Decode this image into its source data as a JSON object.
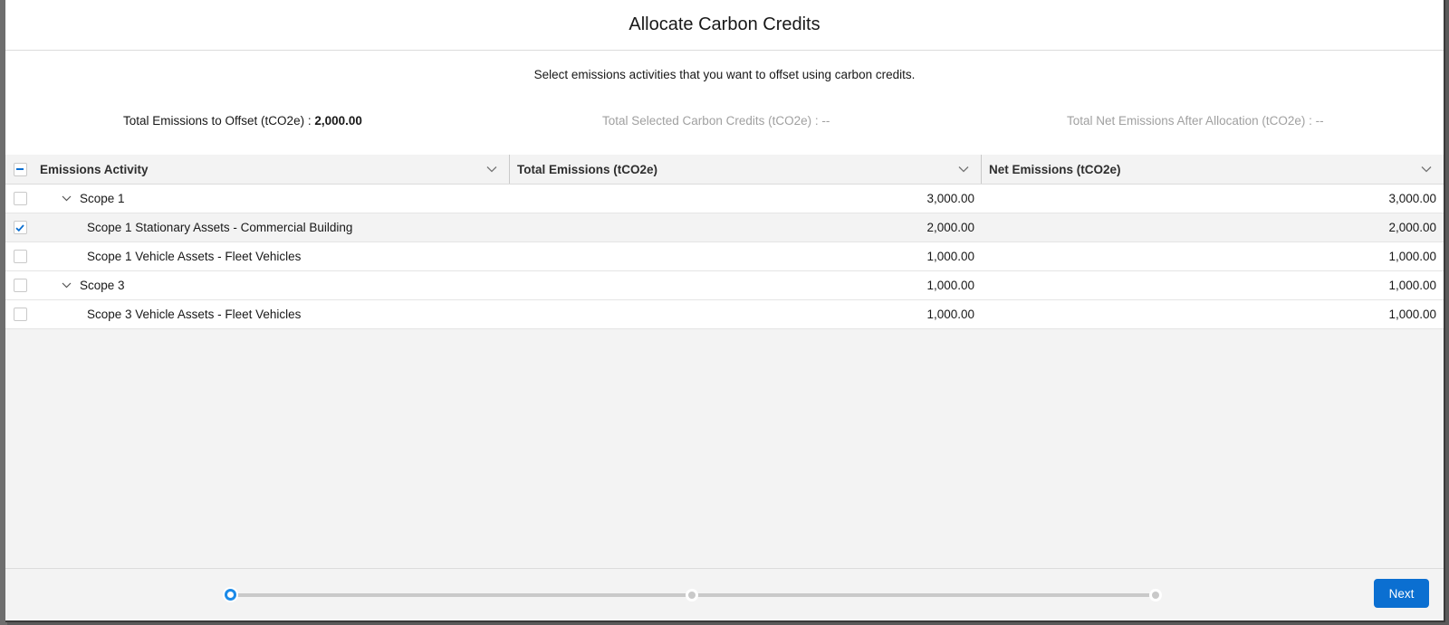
{
  "modal": {
    "title": "Allocate Carbon Credits",
    "instruction": "Select emissions activities that you want to offset using carbon credits."
  },
  "summary": {
    "total_to_offset_label": "Total Emissions to Offset (tCO2e) : ",
    "total_to_offset_value": "2,000.00",
    "selected_credits_label": "Total Selected Carbon Credits (tCO2e) : --",
    "net_after_allocation_label": "Total Net Emissions After Allocation (tCO2e) : --"
  },
  "table": {
    "select_all_state": "indeterminate",
    "columns": [
      {
        "label": "Emissions Activity"
      },
      {
        "label": "Total Emissions (tCO2e)"
      },
      {
        "label": "Net Emissions (tCO2e)"
      }
    ],
    "rows": [
      {
        "activity": "Scope 1",
        "level": 1,
        "expanded": true,
        "checked": false,
        "total": "3,000.00",
        "net": "3,000.00"
      },
      {
        "activity": "Scope 1 Stationary Assets - Commercial Building",
        "level": 2,
        "checked": true,
        "total": "2,000.00",
        "net": "2,000.00"
      },
      {
        "activity": "Scope 1 Vehicle Assets - Fleet Vehicles",
        "level": 2,
        "checked": false,
        "total": "1,000.00",
        "net": "1,000.00"
      },
      {
        "activity": "Scope 3",
        "level": 1,
        "expanded": true,
        "checked": false,
        "total": "1,000.00",
        "net": "1,000.00"
      },
      {
        "activity": "Scope 3 Vehicle Assets - Fleet Vehicles",
        "level": 2,
        "checked": false,
        "total": "1,000.00",
        "net": "1,000.00"
      }
    ]
  },
  "progress": {
    "steps": 3,
    "current_step": 1
  },
  "footer": {
    "next_label": "Next"
  },
  "colors": {
    "brand": "#0b6fd1",
    "progress_active": "#1b8ae8"
  }
}
